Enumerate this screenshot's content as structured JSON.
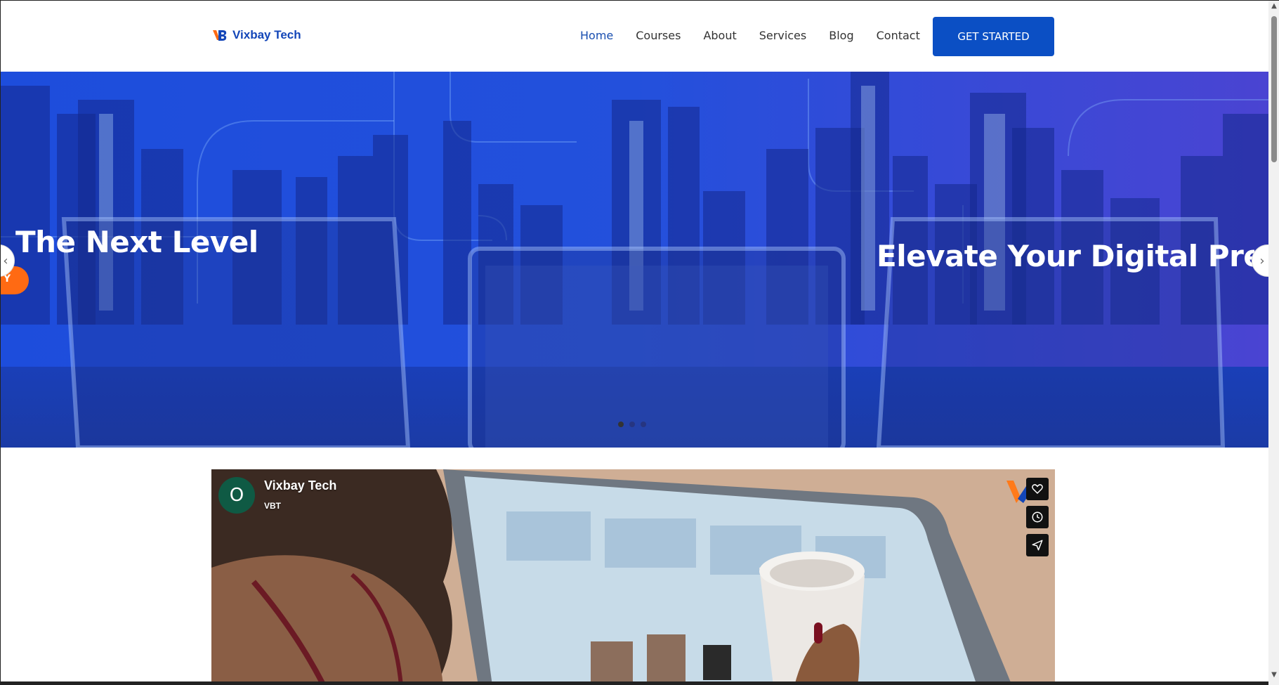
{
  "brand": {
    "name": "Vixbay Tech",
    "logo_icon": "vb-logo-icon",
    "color": "#1346b8",
    "accent": "#ff6a13"
  },
  "nav": {
    "items": [
      {
        "label": "Home",
        "active": true
      },
      {
        "label": "Courses",
        "active": false
      },
      {
        "label": "About",
        "active": false
      },
      {
        "label": "Services",
        "active": false
      },
      {
        "label": "Blog",
        "active": false
      },
      {
        "label": "Contact",
        "active": false
      }
    ],
    "cta_label": "GET STARTED",
    "cta_color": "#0b4fc4"
  },
  "hero": {
    "slide_left_title": "The Next Level",
    "slide_right_title": "Elevate Your Digital Presence",
    "chip_letter": "Y",
    "prev_icon": "chevron-left-icon",
    "next_icon": "chevron-right-icon",
    "dots": {
      "count": 3,
      "active_index": 0
    }
  },
  "video": {
    "channel_avatar_letter": "O",
    "channel_title": "Vixbay Tech",
    "channel_subtitle": "VBT",
    "actions": [
      "heart-icon",
      "clock-icon",
      "share-icon"
    ]
  },
  "scrollbar": {
    "up_icon": "scroll-up-arrow-icon",
    "down_icon": "scroll-down-arrow-icon"
  }
}
